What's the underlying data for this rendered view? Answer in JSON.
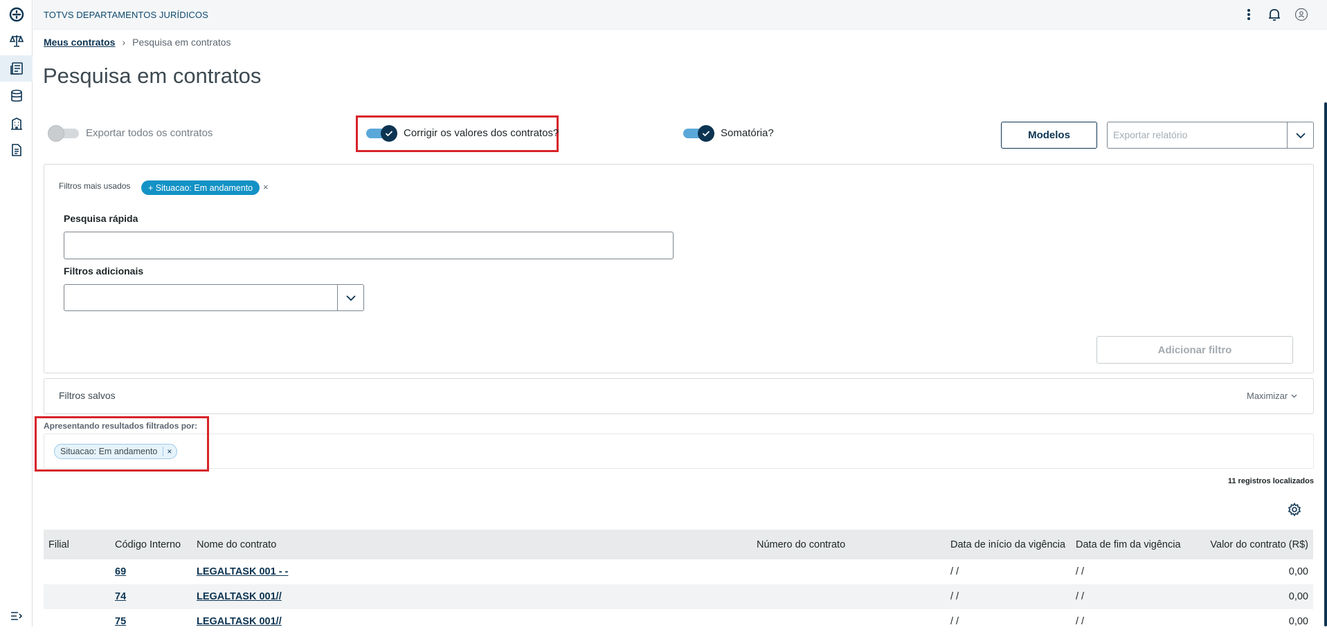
{
  "app": {
    "brand": "TOTVS DEPARTAMENTOS JURÍDICOS"
  },
  "colors": {
    "primary": "#0c3452",
    "accent": "#1392c5",
    "highlight": "#d8232a"
  },
  "sidebar": {
    "icons": [
      "logo-icon",
      "scale-icon",
      "contracts-icon",
      "database-icon",
      "building-icon",
      "document-icon"
    ],
    "bottom_icon": "collapse-menu-icon",
    "active_index": 2
  },
  "topbar": {
    "icons": [
      "more-options-icon",
      "bell-icon",
      "user-icon"
    ]
  },
  "breadcrumb": {
    "root": "Meus contratos",
    "current": "Pesquisa em contratos"
  },
  "page_title": "Pesquisa em contratos",
  "options": {
    "export_all": {
      "label": "Exportar todos os contratos",
      "on": false
    },
    "correct_values": {
      "label": "Corrigir os valores dos contratos?",
      "on": true
    },
    "sum": {
      "label": "Somatória?",
      "on": true
    }
  },
  "buttons": {
    "models": "Modelos",
    "add_filter": "Adicionar filtro"
  },
  "export_report": {
    "placeholder": "Exportar relatório"
  },
  "filters": {
    "most_used_label": "Filtros mais usados",
    "most_used_chip": "+ Situacao: Em andamento",
    "chip_close": "×",
    "quick_search_label": "Pesquisa rápida",
    "quick_search_value": "",
    "additional_label": "Filtros adicionais",
    "additional_value": ""
  },
  "saved_filters": {
    "title": "Filtros salvos",
    "toggle": "Maximizar"
  },
  "applied": {
    "label": "Apresentando resultados filtrados por:",
    "chips": [
      "Situacao: Em andamento"
    ],
    "chip_close": "×"
  },
  "results": {
    "count_text": "11 registros localizados"
  },
  "table": {
    "columns": [
      "Filial",
      "Código Interno",
      "Nome do contrato",
      "Número do contrato",
      "Data de início da vigência",
      "Data de fim da vigência",
      "Valor do contrato (R$)"
    ],
    "rows": [
      {
        "filial": "",
        "codigo": "69",
        "nome": "LEGALTASK 001 - -",
        "numero": "",
        "inicio": "/ /",
        "fim": "/ /",
        "valor": "0,00"
      },
      {
        "filial": "",
        "codigo": "74",
        "nome": "LEGALTASK 001//",
        "numero": "",
        "inicio": "/ /",
        "fim": "/ /",
        "valor": "0,00"
      },
      {
        "filial": "",
        "codigo": "75",
        "nome": "LEGALTASK 001//",
        "numero": "",
        "inicio": "/ /",
        "fim": "/ /",
        "valor": "0,00"
      }
    ]
  }
}
